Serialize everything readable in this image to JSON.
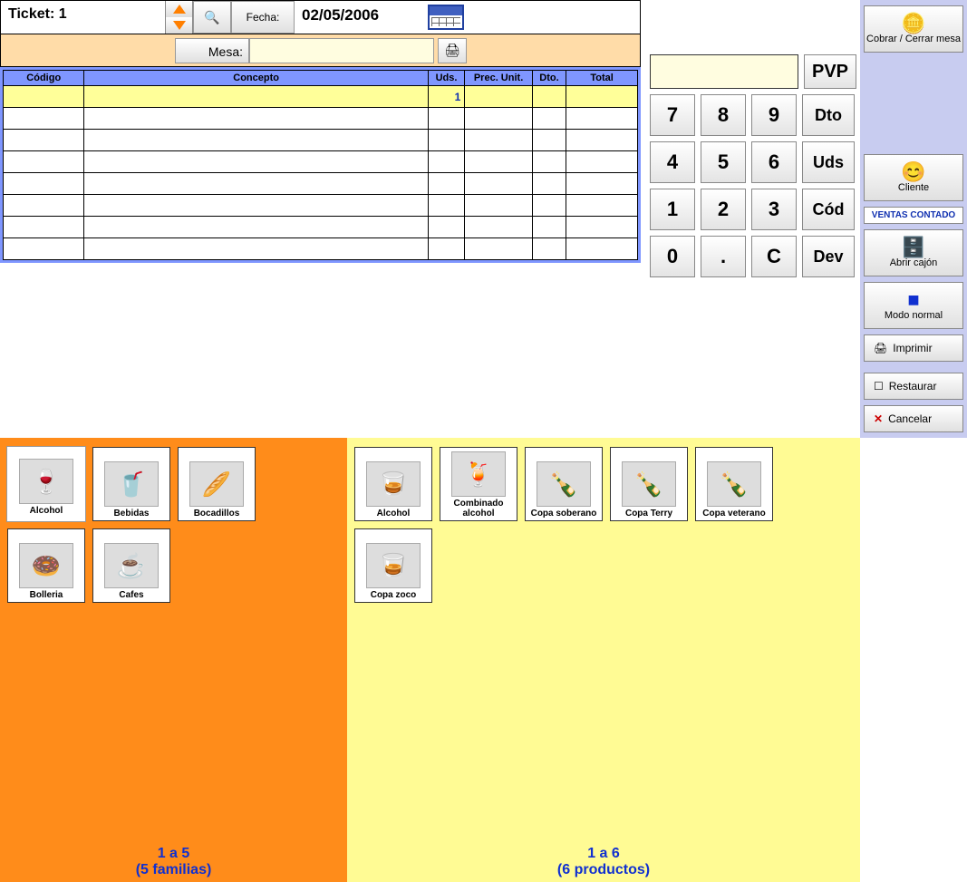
{
  "header": {
    "ticket_label": "Ticket: 1",
    "fecha_label": "Fecha:",
    "date_value": "02/05/2006"
  },
  "mesa": {
    "label": "Mesa:",
    "value": ""
  },
  "table": {
    "headers": {
      "codigo": "Código",
      "concepto": "Concepto",
      "uds": "Uds.",
      "prec": "Prec. Unit.",
      "dto": "Dto.",
      "total": "Total"
    },
    "first_row": {
      "codigo": "",
      "concepto": "",
      "uds": "1",
      "prec": "",
      "dto": "",
      "total": ""
    }
  },
  "keypad": {
    "pvp": "PVP",
    "k7": "7",
    "k8": "8",
    "k9": "9",
    "dto": "Dto",
    "k4": "4",
    "k5": "5",
    "k6": "6",
    "uds": "Uds",
    "k1": "1",
    "k2": "2",
    "k3": "3",
    "cod": "Cód",
    "k0": "0",
    "kdot": ".",
    "kc": "C",
    "dev": "Dev"
  },
  "sidebar": {
    "cobrar": "Cobrar / Cerrar mesa",
    "cliente": "Cliente",
    "ventas_contado": "VENTAS CONTADO",
    "abrir_cajon": "Abrir cajón",
    "modo_normal": "Modo normal",
    "imprimir": "Imprimir",
    "restaurar": "Restaurar",
    "cancelar": "Cancelar"
  },
  "families": {
    "items": [
      {
        "label": "Alcohol",
        "icon": "🍷",
        "selected": true
      },
      {
        "label": "Bebidas",
        "icon": "🥤"
      },
      {
        "label": "Bocadillos",
        "icon": "🥖"
      },
      {
        "label": "Bolleria",
        "icon": "🍩"
      },
      {
        "label": "Cafes",
        "icon": "☕"
      }
    ],
    "footer_range": "1 a 5",
    "footer_count": "(5 familias)"
  },
  "products": {
    "items": [
      {
        "label": "Alcohol",
        "icon": "🥃"
      },
      {
        "label": "Combinado alcohol",
        "icon": "🍹"
      },
      {
        "label": "Copa soberano",
        "icon": "🍾"
      },
      {
        "label": "Copa Terry",
        "icon": "🍾"
      },
      {
        "label": "Copa veterano",
        "icon": "🍾"
      },
      {
        "label": "Copa zoco",
        "icon": "🥃"
      }
    ],
    "footer_range": "1 a 6",
    "footer_count": "(6 productos)"
  }
}
